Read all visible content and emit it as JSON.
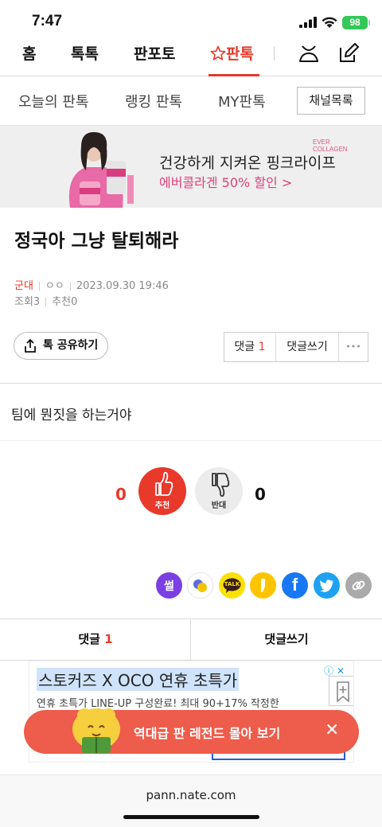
{
  "status": {
    "time": "7:47",
    "battery": "98"
  },
  "topnav": {
    "tabs": [
      {
        "label": "홈"
      },
      {
        "label": "톡톡"
      },
      {
        "label": "판포토"
      },
      {
        "label": "판톡",
        "active": true
      }
    ]
  },
  "subnav": {
    "items": [
      "오늘의 판톡",
      "랭킹 판톡",
      "MY판톡"
    ],
    "channel_button": "채널목록"
  },
  "banner": {
    "brand": "EVER COLLAGEN",
    "headline": "건강하게 지켜온 핑크라이프",
    "sub": "에버콜라겐 50% 할인 >"
  },
  "post": {
    "title": "정국아 그냥 탈퇴해라",
    "category": "군대",
    "author": "ㅇㅇ",
    "datetime": "2023.09.30 19:46",
    "views_label": "조회",
    "views": "3",
    "recommend_label": "추천",
    "recommend": "0",
    "body": "팀에 뭔짓을 하는거야"
  },
  "actions": {
    "share": "톡 공유하기",
    "comments_label": "댓글",
    "comments_count": "1",
    "write_comment": "댓글쓰기",
    "more": "•••"
  },
  "vote": {
    "up_count": "0",
    "up_label": "추천",
    "down_label": "반대",
    "down_count": "0"
  },
  "sns": [
    {
      "name": "ssul",
      "label": "썰",
      "color": "#7b3fe4"
    },
    {
      "name": "band",
      "color": "#ffffff"
    },
    {
      "name": "kakaotalk",
      "label": "TALK",
      "color": "#fae100"
    },
    {
      "name": "kakaostory",
      "color": "#ffc400"
    },
    {
      "name": "facebook",
      "color": "#1877f2"
    },
    {
      "name": "twitter",
      "color": "#1da1f2"
    },
    {
      "name": "link",
      "color": "#aaaaaa"
    }
  ],
  "comment_bar": {
    "comments_label": "댓글",
    "comments_count": "1",
    "write": "댓글쓰기"
  },
  "ad": {
    "title": "스토커즈 X OCO 연휴 초특가",
    "desc": "연휴 초특가 LINE-UP 구성완료! 최대 90+17% 작정한"
  },
  "floating": {
    "text": "역대급 판 레전드 몰아 보기"
  },
  "browser": {
    "url": "pann.nate.com"
  }
}
